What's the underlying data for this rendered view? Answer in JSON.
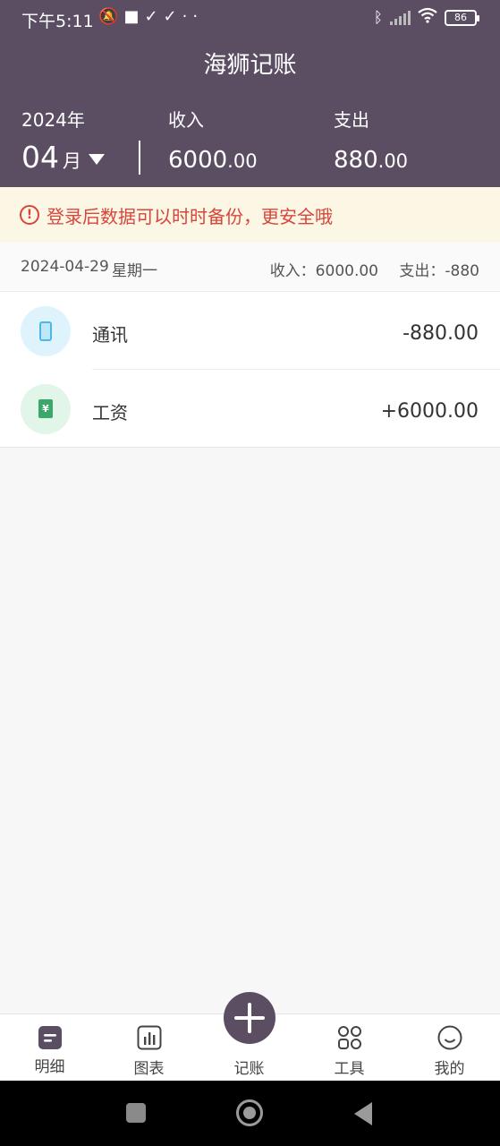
{
  "status_bar": {
    "time": "下午5:11",
    "icons": [
      "bell-muted-icon",
      "square-icon",
      "check-icon",
      "check-icon",
      "dots-icon"
    ],
    "right_icons": [
      "bluetooth-icon",
      "signal-icon",
      "wifi-icon"
    ],
    "battery": "86"
  },
  "header": {
    "title": "海狮记账",
    "year": "2024年",
    "month": "04",
    "month_unit": "月",
    "income_label": "收入",
    "income_value_int": "6000",
    "income_value_dec": ".00",
    "expense_label": "支出",
    "expense_value_int": "880",
    "expense_value_dec": ".00"
  },
  "notice": {
    "icon": "!",
    "text": "登录后数据可以时时备份，更安全哦"
  },
  "day_group": {
    "date": "2024-04-29",
    "weekday": "星期一",
    "income": "收入：6000.00",
    "expense": "支出：-880"
  },
  "transactions": [
    {
      "category": "通讯",
      "amount": "-880.00",
      "icon": "phone-icon",
      "icon_bg": "#dff3fc"
    },
    {
      "category": "工资",
      "amount": "+6000.00",
      "icon": "salary-icon",
      "icon_bg": "#e1f5e8",
      "icon_glyph": "¥"
    }
  ],
  "bottom_nav": {
    "items": [
      {
        "label": "明细",
        "icon": "list-icon"
      },
      {
        "label": "图表",
        "icon": "chart-icon"
      },
      {
        "label": "记账",
        "icon": "plus-icon"
      },
      {
        "label": "工具",
        "icon": "grid-icon"
      },
      {
        "label": "我的",
        "icon": "smile-icon"
      }
    ]
  },
  "colors": {
    "primary": "#5b4e63",
    "warning": "#d8453c",
    "notice_bg": "#fbf7e4"
  }
}
